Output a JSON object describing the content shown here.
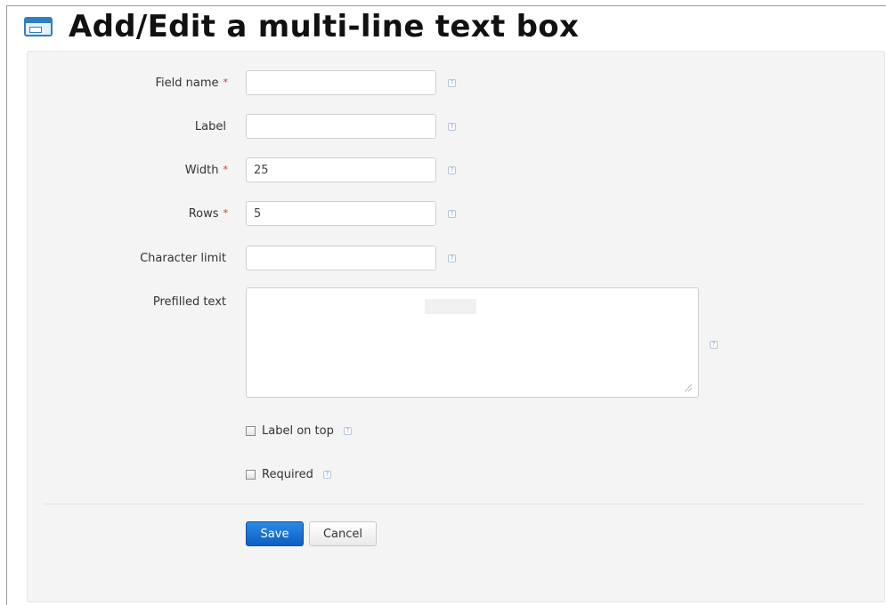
{
  "page": {
    "title": "Add/Edit a multi-line text box",
    "icon": "text-box-icon"
  },
  "form": {
    "fields": [
      {
        "label": "Field name",
        "required": true,
        "value": ""
      },
      {
        "label": "Label",
        "required": false,
        "value": ""
      },
      {
        "label": "Width",
        "required": true,
        "value": "25"
      },
      {
        "label": "Rows",
        "required": true,
        "value": "5"
      },
      {
        "label": "Character limit",
        "required": false,
        "value": ""
      }
    ],
    "prefilled": {
      "label": "Prefilled text",
      "value": ""
    },
    "required_marker": "*",
    "help_glyph": "?",
    "checkboxes": [
      {
        "label": "Label on top",
        "checked": false
      },
      {
        "label": "Required",
        "checked": false
      }
    ]
  },
  "buttons": {
    "save": "Save",
    "cancel": "Cancel"
  },
  "colors": {
    "accent": "#1a6fd0",
    "required": "#d23232",
    "panel": "#f4f4f4"
  }
}
